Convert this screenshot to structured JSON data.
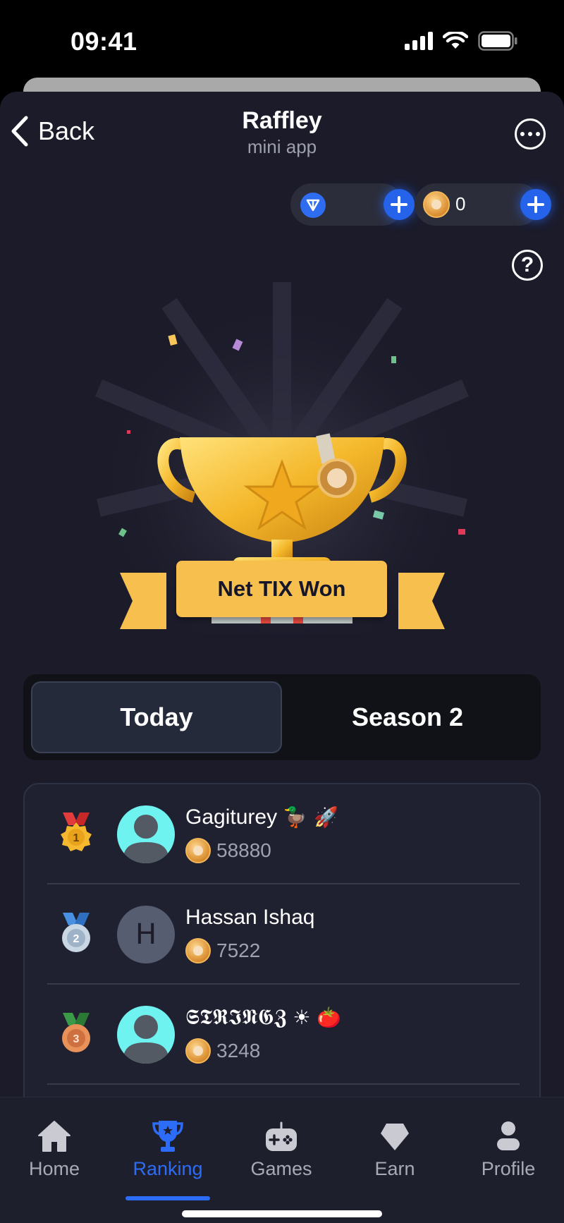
{
  "status_bar": {
    "time": "09:41"
  },
  "header": {
    "back_label": "Back",
    "title": "Raffley",
    "subtitle": "mini app"
  },
  "balances": {
    "ton_value": "",
    "coin_value": "0"
  },
  "hero": {
    "banner_text": "Net TIX Won"
  },
  "tabs": [
    {
      "label": "Today",
      "active": true
    },
    {
      "label": "Season 2",
      "active": false
    }
  ],
  "leaderboard": [
    {
      "rank": "1",
      "name": "Gagiturey",
      "name_emoji": "🦆 🚀",
      "score": "58880",
      "avatar_type": "photo",
      "avatar_letter": ""
    },
    {
      "rank": "2",
      "name": "Hassan Ishaq",
      "name_emoji": "",
      "score": "7522",
      "avatar_type": "letter",
      "avatar_letter": "H"
    },
    {
      "rank": "3",
      "name": "𝕾𝕿𝕽𝕴𝕹𝕲𝖅",
      "name_emoji": "☀ 🍅",
      "score": "3248",
      "avatar_type": "photo",
      "avatar_letter": ""
    }
  ],
  "nav": [
    {
      "label": "Home",
      "icon": "home-icon",
      "active": false
    },
    {
      "label": "Ranking",
      "icon": "trophy-icon",
      "active": true
    },
    {
      "label": "Games",
      "icon": "gamepad-icon",
      "active": false
    },
    {
      "label": "Earn",
      "icon": "gem-icon",
      "active": false
    },
    {
      "label": "Profile",
      "icon": "user-icon",
      "active": false
    }
  ],
  "colors": {
    "accent": "#2563eb",
    "background": "#1b1b2a",
    "banner": "#f7bf4e",
    "avatar_cyan": "#6ef3f1"
  }
}
